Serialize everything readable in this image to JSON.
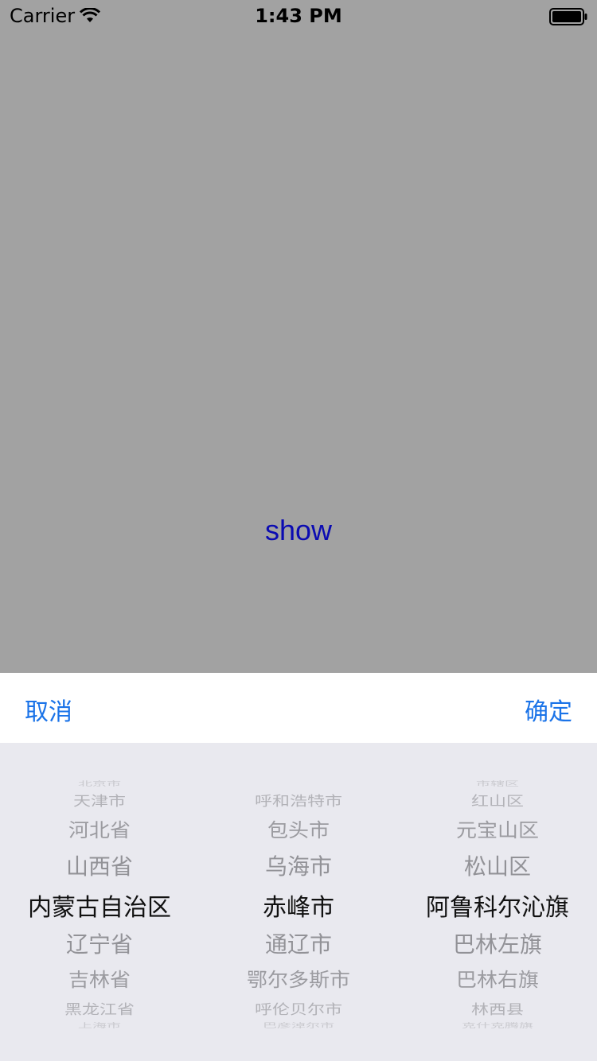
{
  "status": {
    "carrier": "Carrier",
    "time": "1:43 PM"
  },
  "main": {
    "show_label": "show"
  },
  "toolbar": {
    "cancel": "取消",
    "confirm": "确定"
  },
  "picker": {
    "provinces": [
      "北京市",
      "天津市",
      "河北省",
      "山西省",
      "内蒙古自治区",
      "辽宁省",
      "吉林省",
      "黑龙江省",
      "上海市"
    ],
    "cities": [
      "",
      "呼和浩特市",
      "包头市",
      "乌海市",
      "赤峰市",
      "通辽市",
      "鄂尔多斯市",
      "呼伦贝尔市",
      "巴彦淖尔市"
    ],
    "districts": [
      "市辖区",
      "红山区",
      "元宝山区",
      "松山区",
      "阿鲁科尔沁旗",
      "巴林左旗",
      "巴林右旗",
      "林西县",
      "克什克腾旗"
    ],
    "selected": {
      "province": "内蒙古自治区",
      "city": "赤峰市",
      "district": "阿鲁科尔沁旗"
    }
  }
}
